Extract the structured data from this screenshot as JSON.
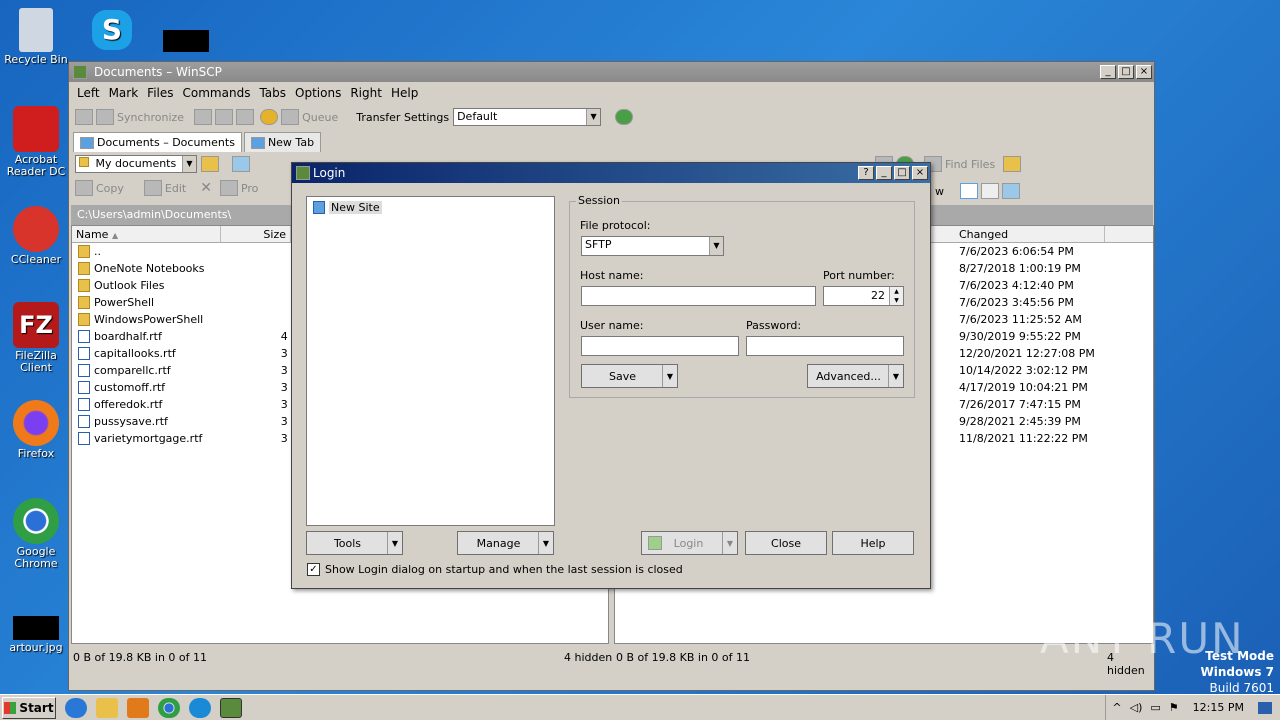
{
  "desktop": {
    "icons": [
      {
        "label": "Recycle Bin",
        "color": "#cfd8e2"
      },
      {
        "label": "Acrobat Reader DC",
        "color": "#d01d1d"
      },
      {
        "label": "CCleaner",
        "color": "#d9342b"
      },
      {
        "label": "FileZilla Client",
        "color": "#b41a1a"
      },
      {
        "label": "Firefox",
        "color": "#f07a1a"
      },
      {
        "label": "Google Chrome",
        "color": "#2f9e44"
      },
      {
        "label": "artour.jpg",
        "color": "#000000"
      }
    ],
    "skype_color": "#1da1e6"
  },
  "window": {
    "title": "Documents – WinSCP",
    "menu": [
      "Left",
      "Mark",
      "Files",
      "Commands",
      "Tabs",
      "Options",
      "Right",
      "Help"
    ],
    "toolbar": {
      "synchronize": "Synchronize",
      "queue": "Queue",
      "transfer_settings": "Transfer Settings",
      "transfer_value": "Default"
    },
    "tabs": [
      "Documents – Documents",
      "New Tab"
    ],
    "left_location": "My documents",
    "left_actions": {
      "copy": "Copy",
      "edit": "Edit",
      "props": "Pro"
    },
    "right_actions": {
      "find": "Find Files",
      "new": "w"
    },
    "left_path": "C:\\Users\\admin\\Documents\\",
    "left_cols": {
      "name": "Name",
      "size": "Size"
    },
    "right_cols": {
      "changed": "Changed"
    },
    "files": [
      {
        "name": "..",
        "size": "",
        "type": "up",
        "changed": "7/6/2023 6:06:54 PM"
      },
      {
        "name": "OneNote Notebooks",
        "size": "",
        "type": "folder",
        "changed": "8/27/2018 1:00:19 PM"
      },
      {
        "name": "Outlook Files",
        "size": "",
        "type": "folder",
        "changed": "7/6/2023 4:12:40 PM"
      },
      {
        "name": "PowerShell",
        "size": "",
        "type": "folder",
        "changed": "7/6/2023 3:45:56 PM"
      },
      {
        "name": "WindowsPowerShell",
        "size": "",
        "type": "folder",
        "changed": "7/6/2023 11:25:52 AM"
      },
      {
        "name": "boardhalf.rtf",
        "size": "4 KB",
        "type": "doc",
        "changed": "9/30/2019 9:55:22 PM"
      },
      {
        "name": "capitallooks.rtf",
        "size": "3 KB",
        "type": "doc",
        "changed": "12/20/2021 12:27:08 PM"
      },
      {
        "name": "comparellc.rtf",
        "size": "3 KB",
        "type": "doc",
        "changed": "10/14/2022 3:02:12 PM"
      },
      {
        "name": "customoff.rtf",
        "size": "3 KB",
        "type": "doc",
        "changed": "4/17/2019 10:04:21 PM"
      },
      {
        "name": "offeredok.rtf",
        "size": "3 KB",
        "type": "doc",
        "changed": "7/26/2017 7:47:15 PM"
      },
      {
        "name": "pussysave.rtf",
        "size": "3 KB",
        "type": "doc",
        "changed": "9/28/2021 2:45:39 PM"
      },
      {
        "name": "varietymortgage.rtf",
        "size": "3 KB",
        "type": "doc",
        "changed": "11/8/2021 11:22:22 PM"
      }
    ],
    "status_left": "0 B of 19.8 KB in 0 of 11",
    "hidden_left": "4 hidden",
    "status_right": "0 B of 19.8 KB in 0 of 11",
    "hidden_right": "4 hidden"
  },
  "login": {
    "title": "Login",
    "site": "New Site",
    "session_label": "Session",
    "protocol_label": "File protocol:",
    "protocol_value": "SFTP",
    "host_label": "Host name:",
    "host_value": "",
    "port_label": "Port number:",
    "port_value": "22",
    "user_label": "User name:",
    "user_value": "",
    "pass_label": "Password:",
    "save": "Save",
    "advanced": "Advanced...",
    "tools": "Tools",
    "manage": "Manage",
    "login": "Login",
    "close": "Close",
    "help": "Help",
    "show_dialog": "Show Login dialog on startup and when the last session is closed",
    "show_dialog_checked": true
  },
  "taskbar": {
    "start": "Start",
    "clock": "12:15 PM"
  },
  "watermark": "ANY RUN",
  "testmode": [
    "Test Mode",
    "Windows 7",
    "Build 7601"
  ]
}
